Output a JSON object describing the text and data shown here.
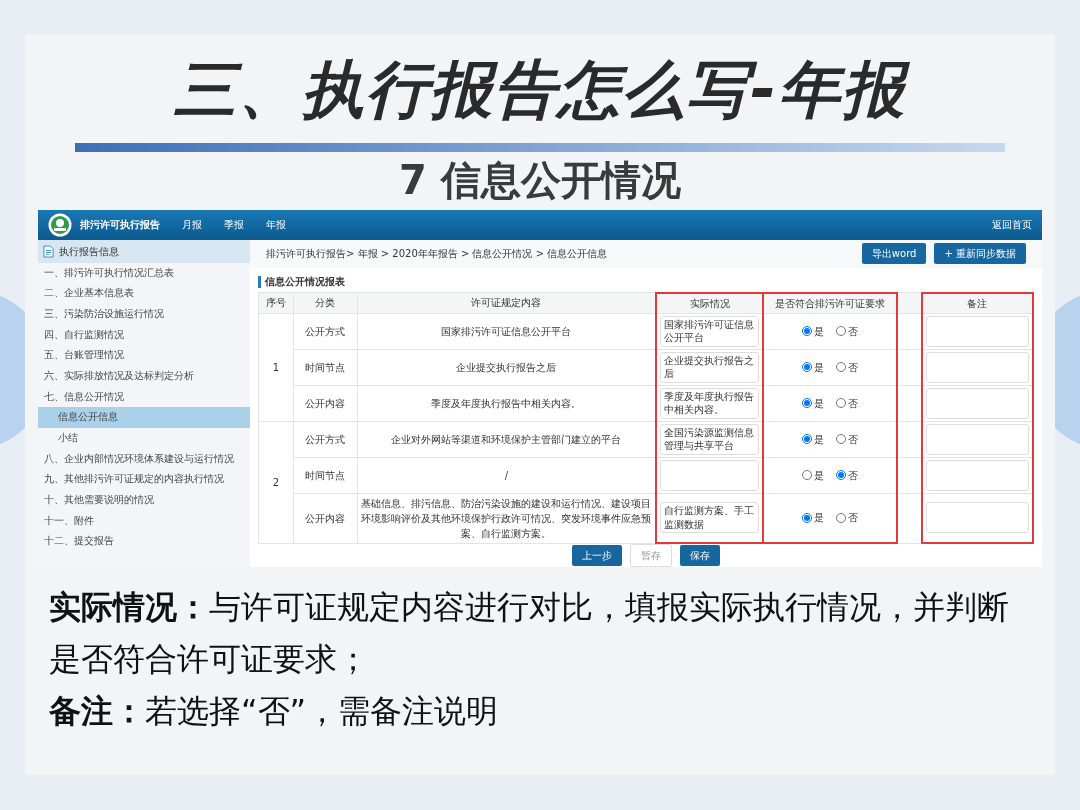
{
  "slide": {
    "title": "三、执行报告怎么写-年报",
    "subtitle": "7 信息公开情况",
    "notes": [
      "**实际情况：**与许可证规定内容进行对比，填报实际执行情况，并判断是否符合许可证要求；",
      "**备注：**若选择“否”，需备注说明"
    ]
  },
  "app": {
    "brand": "排污许可执行报告",
    "nav": [
      "月报",
      "季报",
      "年报"
    ],
    "home_link": "返回首页",
    "breadcrumb": "排污许可执行报告> 年报 > 2020年年报告 > 信息公开情况 > 信息公开信息",
    "toolbar_buttons": [
      "导出word",
      "+ 重新同步数据"
    ],
    "sidebar": {
      "header": "执行报告信息",
      "items": [
        {
          "label": "一、排污许可执行情况汇总表",
          "selected": false
        },
        {
          "label": "二、企业基本信息表",
          "selected": false
        },
        {
          "label": "三、污染防治设施运行情况",
          "selected": false
        },
        {
          "label": "四、自行监测情况",
          "selected": false
        },
        {
          "label": "五、台账管理情况",
          "selected": false
        },
        {
          "label": "六、实际排放情况及达标判定分析",
          "selected": false
        },
        {
          "label": "七、信息公开情况",
          "selected": false,
          "children": [
            {
              "label": "信息公开信息",
              "selected": true
            },
            {
              "label": "小结",
              "selected": false
            }
          ]
        },
        {
          "label": "八、企业内部情况环境体系建设与运行情况",
          "selected": false
        },
        {
          "label": "九、其他排污许可证规定的内容执行情况",
          "selected": false
        },
        {
          "label": "十、其他需要说明的情况",
          "selected": false
        },
        {
          "label": "十一、附件",
          "selected": false
        },
        {
          "label": "十二、提交报告",
          "selected": false
        }
      ]
    },
    "form": {
      "title": "信息公开情况报表",
      "columns": [
        {
          "label": "序号",
          "highlighted": false
        },
        {
          "label": "分类",
          "highlighted": false
        },
        {
          "label": "许可证规定内容",
          "highlighted": false
        },
        {
          "label": "实际情况",
          "highlighted": true
        },
        {
          "label": "是否符合排污许可证要求",
          "highlighted": true
        },
        {
          "label": "备注",
          "highlighted": true
        }
      ],
      "groups": [
        {
          "number": "1",
          "rows": [
            {
              "category": "公开方式",
              "content": "国家排污许可证信息公开平台",
              "actual": "国家排污许可证信息公开平台",
              "options": [
                {
                  "label": "是",
                  "selected": true
                },
                {
                  "label": "否",
                  "selected": false
                }
              ]
            },
            {
              "category": "时间节点",
              "content": "企业提交执行报告之后",
              "actual": "企业提交执行报告之后",
              "options": [
                {
                  "label": "是",
                  "selected": true
                },
                {
                  "label": "否",
                  "selected": false
                }
              ]
            },
            {
              "category": "公开内容",
              "content": "季度及年度执行报告中相关内容。",
              "actual": "季度及年度执行报告中相关内容。",
              "options": [
                {
                  "label": "是",
                  "selected": true
                },
                {
                  "label": "否",
                  "selected": false
                }
              ]
            }
          ]
        },
        {
          "number": "2",
          "rows": [
            {
              "category": "公开方式",
              "content": "企业对外网站等渠道和环境保护主管部门建立的平台",
              "actual": "全国污染源监测信息管理与共享平台",
              "options": [
                {
                  "label": "是",
                  "selected": true
                },
                {
                  "label": "否",
                  "selected": false
                }
              ]
            },
            {
              "category": "时间节点",
              "content": "/",
              "options": [
                {
                  "label": "是",
                  "selected": false
                },
                {
                  "label": "否",
                  "selected": true
                }
              ]
            },
            {
              "category": "公开内容",
              "content": "基础信息、排污信息、防治污染设施的建设和运行情况、建设项目环境影响评价及其他环境保护行政许可情况、突发环境事件应急预案、自行监测方案。",
              "actual": "自行监测方案、手工监测数据",
              "options": [
                {
                  "label": "是",
                  "selected": true
                },
                {
                  "label": "否",
                  "selected": false
                }
              ]
            }
          ]
        }
      ],
      "buttons": [
        {
          "label": "上一步",
          "kind": "primary"
        },
        {
          "label": "暂存",
          "kind": "plain"
        },
        {
          "label": "保存",
          "kind": "primary"
        }
      ]
    }
  }
}
